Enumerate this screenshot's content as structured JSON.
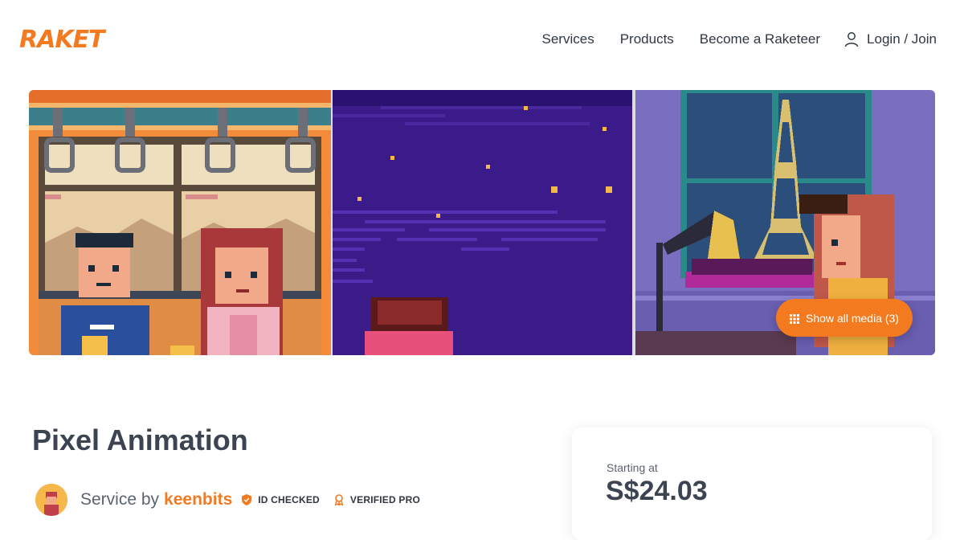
{
  "brand": {
    "logo_text": "RAKET",
    "accent": "#f47a20",
    "text_color": "#2f3742"
  },
  "nav": {
    "items": [
      "Services",
      "Products",
      "Become a Raketeer"
    ],
    "login_label": "Login / Join"
  },
  "gallery": {
    "tiles": [
      {
        "icon": "pixel-art-train-couple"
      },
      {
        "icon": "pixel-art-night-sky"
      },
      {
        "icon": "pixel-art-paris-window"
      }
    ],
    "show_media_label": "Show all media (3)"
  },
  "service": {
    "title": "Pixel Animation",
    "service_by_label": "Service by",
    "seller_name": "keenbits",
    "badges": [
      "ID CHECKED",
      "VERIFIED PRO"
    ]
  },
  "pricing": {
    "starting_at_label": "Starting at",
    "price": "S$24.03"
  }
}
